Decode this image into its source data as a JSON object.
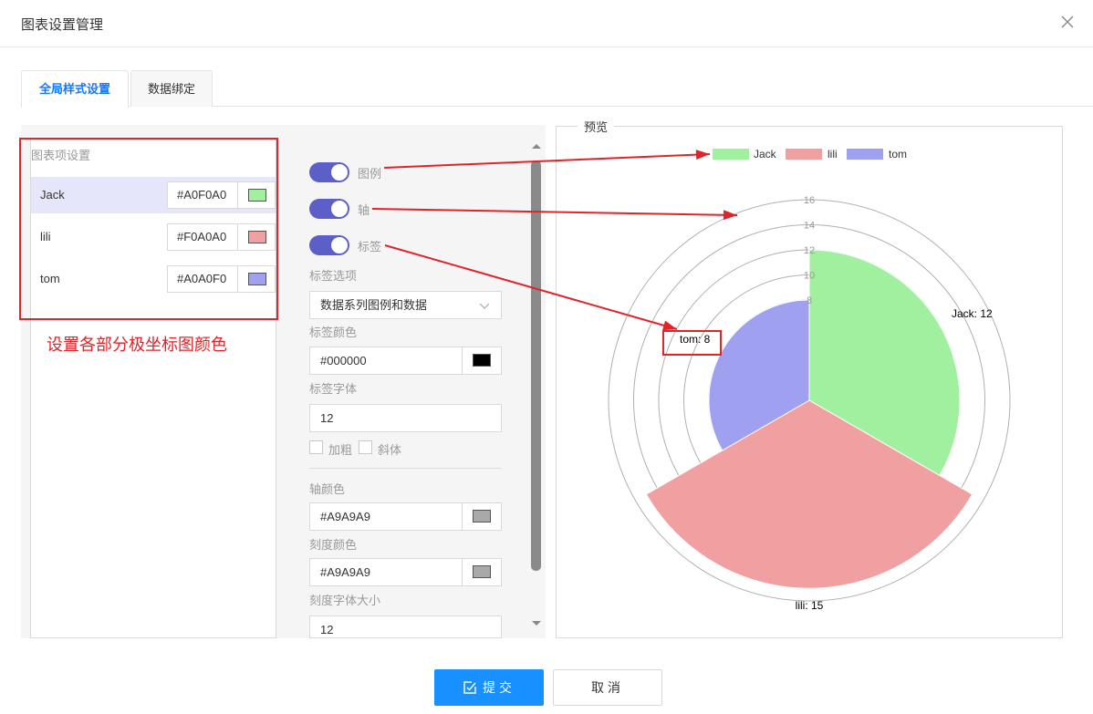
{
  "dialog": {
    "title": "图表设置管理"
  },
  "tabs": [
    {
      "label": "全局样式设置",
      "active": true
    },
    {
      "label": "数据绑定",
      "active": false
    }
  ],
  "left_panel": {
    "title": "图表项设置",
    "items": [
      {
        "name": "Jack",
        "hex": "#A0F0A0",
        "color": "#A0F0A0",
        "selected": true
      },
      {
        "name": "lili",
        "hex": "#F0A0A0",
        "color": "#F0A0A0",
        "selected": false
      },
      {
        "name": "tom",
        "hex": "#A0A0F0",
        "color": "#A0A0F0",
        "selected": false
      }
    ],
    "annotation": "设置各部分极坐标图颜色"
  },
  "settings": {
    "legend_toggle": {
      "label": "图例",
      "on": true
    },
    "axis_toggle": {
      "label": "轴",
      "on": true
    },
    "label_toggle": {
      "label": "标签",
      "on": true
    },
    "label_option_label": "标签选项",
    "label_option_value": "数据系列图例和数据",
    "label_color_label": "标签颜色",
    "label_color_value": "#000000",
    "label_color": "#000000",
    "label_font_label": "标签字体",
    "label_font_value": "12",
    "bold_label": "加粗",
    "italic_label": "斜体",
    "axis_color_label": "轴颜色",
    "axis_color_value": "#A9A9A9",
    "axis_color": "#A9A9A9",
    "tick_color_label": "刻度颜色",
    "tick_color_value": "#A9A9A9",
    "tick_color": "#A9A9A9",
    "tick_font_label": "刻度字体大小",
    "tick_font_value": "12"
  },
  "preview": {
    "title": "预览"
  },
  "chart_data": {
    "type": "polar-area",
    "categories": [
      "Jack",
      "lili",
      "tom"
    ],
    "values": [
      12,
      15,
      8
    ],
    "colors": [
      "#A0F0A0",
      "#F0A0A0",
      "#A0A0F0"
    ],
    "data_labels": [
      "Jack: 12",
      "lili: 15",
      "tom: 8"
    ],
    "legend": [
      "Jack",
      "lili",
      "tom"
    ],
    "legend_position": "top",
    "radial_ticks": [
      "8",
      "10",
      "12",
      "14",
      "16"
    ],
    "radial_range": [
      0,
      16
    ],
    "grid": true,
    "highlighted_label": "tom: 8"
  },
  "buttons": {
    "submit": "提交",
    "cancel": "取消"
  }
}
